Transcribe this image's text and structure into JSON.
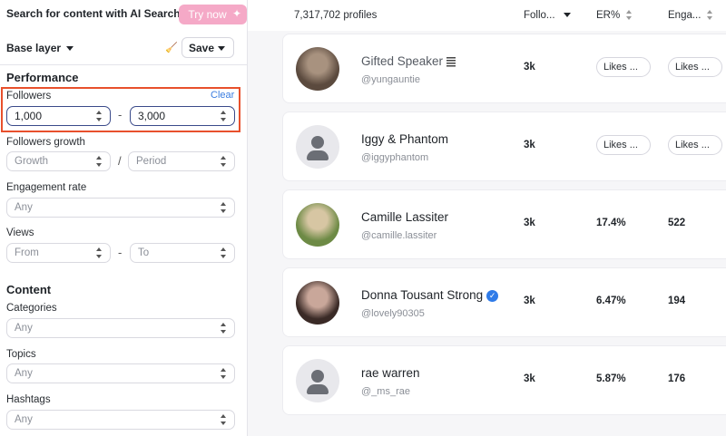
{
  "ai_search": {
    "label": "Search for content with AI Search",
    "button": "Try now"
  },
  "layer": {
    "label": "Base layer",
    "save": "Save"
  },
  "performance": {
    "title": "Performance",
    "followers": {
      "label": "Followers",
      "clear": "Clear",
      "min": "1,000",
      "max": "3,000",
      "separator": "-"
    },
    "followers_growth": {
      "label": "Followers growth",
      "growth": "Growth",
      "period": "Period",
      "separator": "/"
    },
    "engagement_rate": {
      "label": "Engagement rate",
      "value": "Any"
    },
    "views": {
      "label": "Views",
      "from": "From",
      "to": "To",
      "separator": "-"
    }
  },
  "content": {
    "title": "Content",
    "categories": {
      "label": "Categories",
      "value": "Any"
    },
    "topics": {
      "label": "Topics",
      "value": "Any"
    },
    "hashtags": {
      "label": "Hashtags",
      "value": "Any"
    }
  },
  "results": {
    "count": "7,317,702 profiles",
    "columns": {
      "followers": "Follo...",
      "er": "ER%",
      "engagement": "Enga..."
    },
    "rows": [
      {
        "name": "Gifted Speaker",
        "handle": "@yungauntie",
        "followers": "3k",
        "er": "Likes ...",
        "engagement": "Likes ...",
        "er_pill": true,
        "verified": false,
        "avatar": "photo",
        "colors": [
          "#5b4a3e",
          "#a8927f"
        ]
      },
      {
        "name": "Iggy & Phantom",
        "handle": "@iggyphantom",
        "followers": "3k",
        "er": "Likes ...",
        "engagement": "Likes ...",
        "er_pill": true,
        "verified": false,
        "avatar": "placeholder"
      },
      {
        "name": "Camille Lassiter",
        "handle": "@camille.lassiter",
        "followers": "3k",
        "er": "17.4%",
        "engagement": "522",
        "er_pill": false,
        "verified": false,
        "avatar": "photo",
        "colors": [
          "#6d8a45",
          "#d7c6a3"
        ]
      },
      {
        "name": "Donna Tousant Strong",
        "handle": "@lovely90305",
        "followers": "3k",
        "er": "6.47%",
        "engagement": "194",
        "er_pill": false,
        "verified": true,
        "avatar": "photo",
        "colors": [
          "#3a2a26",
          "#c9a79a"
        ]
      },
      {
        "name": "rae warren",
        "handle": "@_ms_rae",
        "followers": "3k",
        "er": "5.87%",
        "engagement": "176",
        "er_pill": false,
        "verified": false,
        "avatar": "placeholder"
      }
    ]
  }
}
